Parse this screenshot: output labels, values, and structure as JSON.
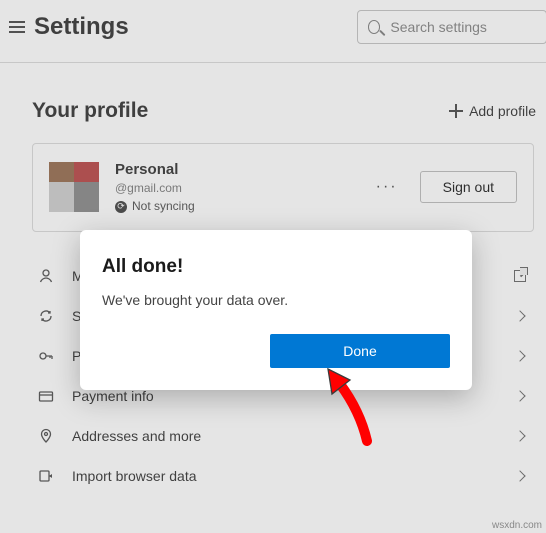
{
  "header": {
    "title": "Settings",
    "search_placeholder": "Search settings"
  },
  "section": {
    "title": "Your profile",
    "add_profile": "Add profile"
  },
  "profile": {
    "name": "Personal",
    "email": "@gmail.com",
    "sync_status": "Not syncing",
    "more_glyph": "···",
    "signout": "Sign out"
  },
  "menu": {
    "manage_account": "Manage account",
    "sync": "Sync",
    "passwords": "Passwords",
    "payment": "Payment info",
    "addresses": "Addresses and more",
    "import": "Import browser data"
  },
  "modal": {
    "title": "All done!",
    "body": "We've brought your data over.",
    "done": "Done"
  },
  "watermark": "wsxdn.com"
}
